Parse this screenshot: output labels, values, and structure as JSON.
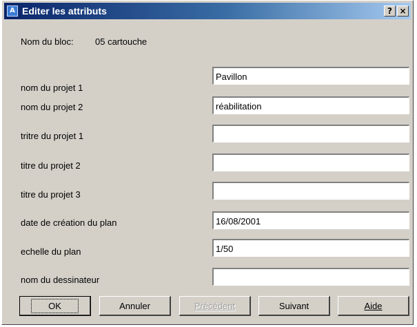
{
  "window": {
    "title": "Editer les attributs",
    "help_glyph": "?",
    "close_glyph": "×"
  },
  "block": {
    "label": "Nom du bloc:",
    "value": "05 cartouche"
  },
  "fields": [
    {
      "label": "nom du projet 1",
      "value": "Pavillon"
    },
    {
      "label": "nom du projet 2",
      "value": "réabilitation"
    },
    {
      "label": "tritre du projet 1",
      "value": ""
    },
    {
      "label": "titre du projet 2",
      "value": ""
    },
    {
      "label": "titre du projet 3",
      "value": ""
    },
    {
      "label": "date de création du plan",
      "value": "16/08/2001"
    },
    {
      "label": "echelle du plan",
      "value": "1/50"
    },
    {
      "label": "nom du dessinateur",
      "value": ""
    }
  ],
  "buttons": {
    "ok": "OK",
    "cancel": "Annuler",
    "previous": "Précédent",
    "next": "Suivant",
    "help": "Aide"
  }
}
